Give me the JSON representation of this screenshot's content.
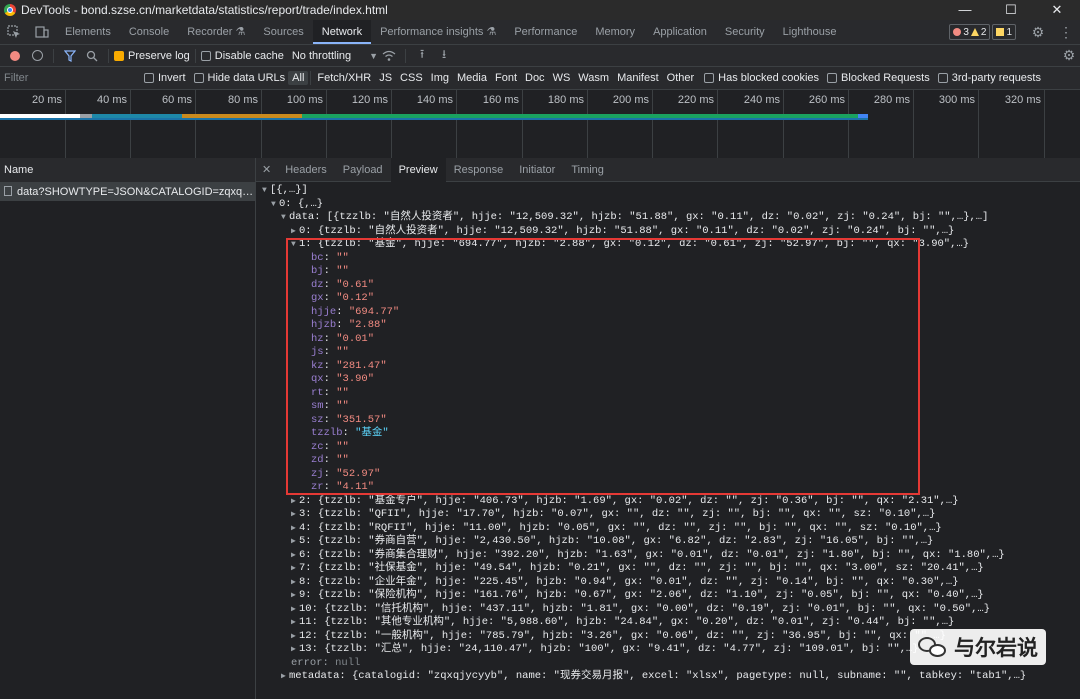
{
  "window": {
    "title": "DevTools - bond.szse.cn/marketdata/statistics/report/trade/index.html",
    "minimize": "—",
    "maximize": "☐",
    "close": "✕"
  },
  "tabs": [
    {
      "label": "Elements"
    },
    {
      "label": "Console"
    },
    {
      "label": "Recorder ⚗"
    },
    {
      "label": "Sources"
    },
    {
      "label": "Network"
    },
    {
      "label": "Performance insights ⚗"
    },
    {
      "label": "Performance"
    },
    {
      "label": "Memory"
    },
    {
      "label": "Application"
    },
    {
      "label": "Security"
    },
    {
      "label": "Lighthouse"
    }
  ],
  "issues": {
    "errors": "3",
    "warnings": "2",
    "info": "1"
  },
  "toolbar": {
    "preserve_log": "Preserve log",
    "disable_cache": "Disable cache",
    "throttling": "No throttling"
  },
  "filter": {
    "placeholder": "Filter",
    "invert": "Invert",
    "hide_data_urls": "Hide data URLs",
    "types": [
      "All",
      "Fetch/XHR",
      "JS",
      "CSS",
      "Img",
      "Media",
      "Font",
      "Doc",
      "WS",
      "Wasm",
      "Manifest",
      "Other"
    ],
    "blocked_cookies": "Has blocked cookies",
    "blocked_requests": "Blocked Requests",
    "third_party": "3rd-party requests"
  },
  "timeline": {
    "ticks": [
      "20 ms",
      "40 ms",
      "60 ms",
      "80 ms",
      "100 ms",
      "120 ms",
      "140 ms",
      "160 ms",
      "180 ms",
      "200 ms",
      "220 ms",
      "240 ms",
      "260 ms",
      "280 ms",
      "300 ms",
      "320 ms"
    ]
  },
  "requests": {
    "header": "Name",
    "items": [
      "data?SHOWTYPE=JSON&CATALOGID=zqxqjycyyb..."
    ]
  },
  "detail_tabs": [
    "Headers",
    "Payload",
    "Preview",
    "Response",
    "Initiator",
    "Timing"
  ],
  "preview": {
    "root": "[{,…}]",
    "item0": "0: {,…}",
    "data_summary": "data: [{tzzlb: \"自然人投资者\", hjje: \"12,509.32\", hjzb: \"51.88\", gx: \"0.11\", dz: \"0.02\", zj: \"0.24\", bj: \"\",…},…]",
    "row0": "0: {tzzlb: \"自然人投资者\", hjje: \"12,509.32\", hjzb: \"51.88\", gx: \"0.11\", dz: \"0.02\", zj: \"0.24\", bj: \"\",…}",
    "row1": "1: {tzzlb: \"基金\", hjje: \"694.77\", hjzb: \"2.88\", gx: \"0.12\", dz: \"0.61\", zj: \"52.97\", bj: \"\", qx: \"3.90\",…}",
    "row1_fields": [
      {
        "k": "bc",
        "v": "\"\""
      },
      {
        "k": "bj",
        "v": "\"\""
      },
      {
        "k": "dz",
        "v": "\"0.61\""
      },
      {
        "k": "gx",
        "v": "\"0.12\""
      },
      {
        "k": "hjje",
        "v": "\"694.77\""
      },
      {
        "k": "hjzb",
        "v": "\"2.88\""
      },
      {
        "k": "hz",
        "v": "\"0.01\""
      },
      {
        "k": "js",
        "v": "\"\""
      },
      {
        "k": "kz",
        "v": "\"281.47\""
      },
      {
        "k": "qx",
        "v": "\"3.90\""
      },
      {
        "k": "rt",
        "v": "\"\""
      },
      {
        "k": "sm",
        "v": "\"\""
      },
      {
        "k": "sz",
        "v": "\"351.57\""
      },
      {
        "k": "tzzlb",
        "v": "\"基金\""
      },
      {
        "k": "zc",
        "v": "\"\""
      },
      {
        "k": "zd",
        "v": "\"\""
      },
      {
        "k": "zj",
        "v": "\"52.97\""
      },
      {
        "k": "zr",
        "v": "\"4.11\""
      }
    ],
    "rows": [
      "2: {tzzlb: \"基金专户\", hjje: \"406.73\", hjzb: \"1.69\", gx: \"0.02\", dz: \"\", zj: \"0.36\", bj: \"\", qx: \"2.31\",…}",
      "3: {tzzlb: \"QFII\", hjje: \"17.70\", hjzb: \"0.07\", gx: \"\", dz: \"\", zj: \"\", bj: \"\", qx: \"\", sz: \"0.10\",…}",
      "4: {tzzlb: \"RQFII\", hjje: \"11.00\", hjzb: \"0.05\", gx: \"\", dz: \"\", zj: \"\", bj: \"\", qx: \"\", sz: \"0.10\",…}",
      "5: {tzzlb: \"券商自营\", hjje: \"2,430.50\", hjzb: \"10.08\", gx: \"6.82\", dz: \"2.83\", zj: \"16.05\", bj: \"\",…}",
      "6: {tzzlb: \"券商集合理财\", hjje: \"392.20\", hjzb: \"1.63\", gx: \"0.01\", dz: \"0.01\", zj: \"1.80\", bj: \"\", qx: \"1.80\",…}",
      "7: {tzzlb: \"社保基金\", hjje: \"49.54\", hjzb: \"0.21\", gx: \"\", dz: \"\", zj: \"\", bj: \"\", qx: \"3.00\", sz: \"20.41\",…}",
      "8: {tzzlb: \"企业年金\", hjje: \"225.45\", hjzb: \"0.94\", gx: \"0.01\", dz: \"\", zj: \"0.14\", bj: \"\", qx: \"0.30\",…}",
      "9: {tzzlb: \"保险机构\", hjje: \"161.76\", hjzb: \"0.67\", gx: \"2.06\", dz: \"1.10\", zj: \"0.05\", bj: \"\", qx: \"0.40\",…}",
      "10: {tzzlb: \"信托机构\", hjje: \"437.11\", hjzb: \"1.81\", gx: \"0.00\", dz: \"0.19\", zj: \"0.01\", bj: \"\", qx: \"0.50\",…}",
      "11: {tzzlb: \"其他专业机构\", hjje: \"5,988.60\", hjzb: \"24.84\", gx: \"0.20\", dz: \"0.01\", zj: \"0.44\", bj: \"\",…}",
      "12: {tzzlb: \"一般机构\", hjje: \"785.79\", hjzb: \"3.26\", gx: \"0.06\", dz: \"\", zj: \"36.95\", bj: \"\", qx: \"\",…}",
      "13: {tzzlb: \"汇总\", hjje: \"24,110.47\", hjzb: \"100\", gx: \"9.41\", dz: \"4.77\", zj: \"109.01\", bj: \"\",…}"
    ],
    "error_key": "error:",
    "error_val": "null",
    "metadata": "metadata: {catalogid: \"zqxqjycyyb\", name: \"现券交易月报\", excel: \"xlsx\", pagetype: null, subname: \"\", tabkey: \"tab1\",…}"
  },
  "watermark": {
    "text": "与尔岩说"
  },
  "colors": {
    "accent": "#8ab4f8",
    "highlight_box": "#e53935",
    "string": "#f28b82"
  }
}
